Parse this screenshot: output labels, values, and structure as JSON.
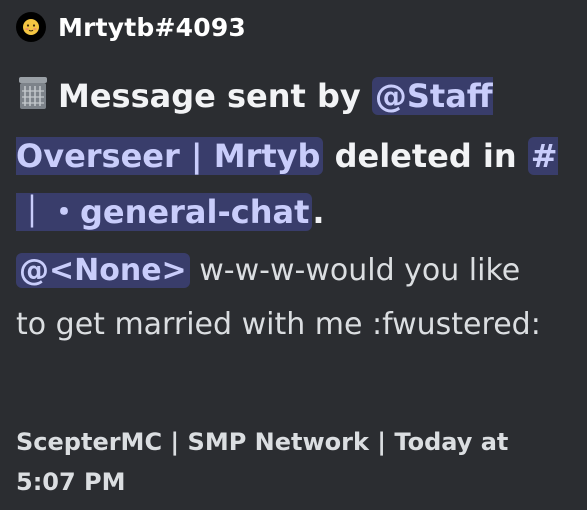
{
  "author": {
    "name": "Mrtytb#4093",
    "avatar_icon": "blushing-face-icon"
  },
  "title": {
    "icon": "wastebasket-icon",
    "prefix": "Message sent by",
    "user_mention": "@Staff Overseer | Mrtyb",
    "middle": "deleted in",
    "channel_mention": "# ｜・general-chat",
    "suffix": "."
  },
  "description": {
    "role_mention": "@<None>",
    "message": "w-w-w-would you like to get married with me :fwustered:"
  },
  "footer": {
    "text": "ScepterMC | SMP Network | Today at 5:07 PM"
  },
  "colors": {
    "background": "#2b2d31",
    "mention_bg": "#4f5494",
    "mention_text": "#c9cdfb",
    "text": "#dbdee1"
  }
}
